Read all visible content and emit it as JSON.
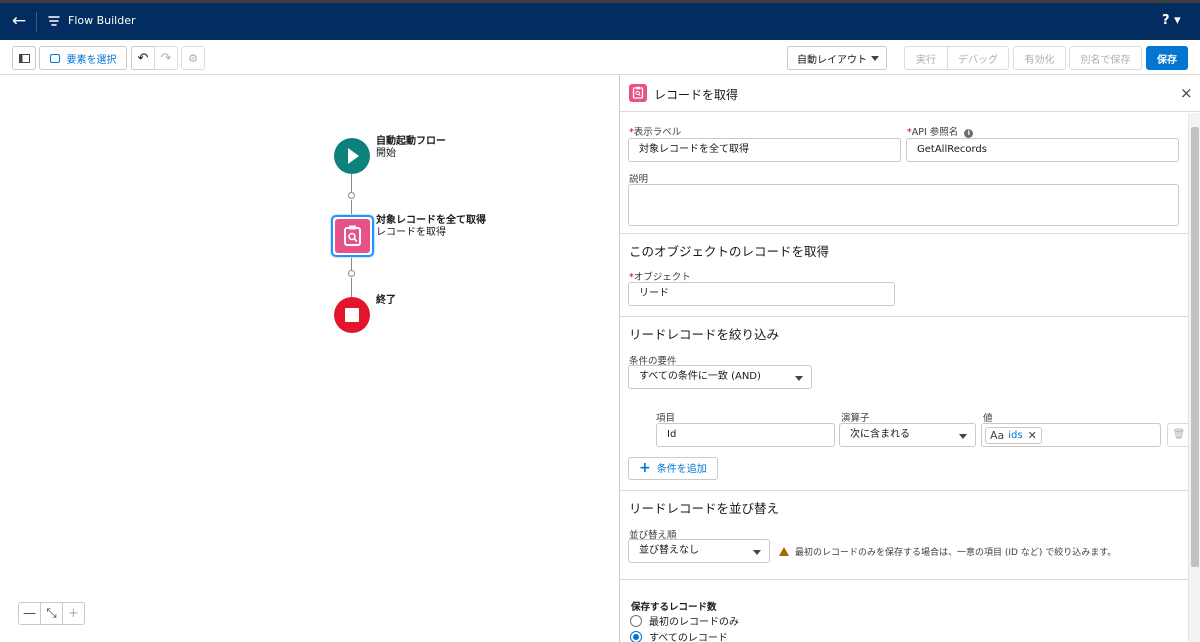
{
  "header": {
    "app_title": "Flow Builder",
    "help_label": "? ▾"
  },
  "toolbar": {
    "select_elements": "要素を選択",
    "layout_dropdown": "自動レイアウト",
    "run": "実行",
    "debug": "デバッグ",
    "activate": "有効化",
    "save_as": "別名で保存",
    "save": "保存"
  },
  "canvas": {
    "start_title": "自動起動フロー",
    "start_subtitle": "開始",
    "get_title": "対象レコードを全て取得",
    "get_subtitle": "レコードを取得",
    "end_title": "終了",
    "zoom_out": "—",
    "zoom_fit": "⤡",
    "zoom_in": "+"
  },
  "panel": {
    "title": "レコードを取得",
    "close": "×",
    "label_field": {
      "label": "表示ラベル",
      "value": "対象レコードを全て取得"
    },
    "api_field": {
      "label": "API 参照名",
      "value": "GetAllRecords"
    },
    "description_label": "説明",
    "object_section": "このオブジェクトのレコードを取得",
    "object_field": {
      "label": "オブジェクト",
      "value": "リード"
    },
    "filter_section": "リードレコードを絞り込み",
    "condition_req_label": "条件の要件",
    "condition_req_value": "すべての条件に一致 (AND)",
    "condition": {
      "field_header": "項目",
      "operator_header": "演算子",
      "value_header": "値",
      "field_value": "Id",
      "operator_value": "次に含まれる",
      "value_pill": "ids",
      "value_pill_icon": "Aa"
    },
    "add_condition": "条件を追加",
    "sort_section": "リードレコードを並び替え",
    "sort_label": "並び替え順",
    "sort_value": "並び替えなし",
    "sort_warning": "最初のレコードのみを保存する場合は、一意の項目 (ID など) で絞り込みます。",
    "store_label": "保存するレコード数",
    "store_options": [
      "最初のレコードのみ",
      "すべてのレコード"
    ],
    "store_selected_index": 1
  }
}
